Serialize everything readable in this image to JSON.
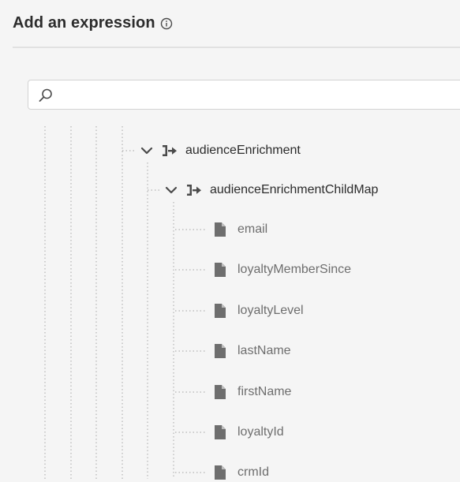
{
  "header": {
    "title": "Add an expression",
    "info_icon": "info-icon"
  },
  "search": {
    "value": "",
    "placeholder": "",
    "icon": "search-icon"
  },
  "tree": {
    "parent": {
      "label": "audienceEnrichment",
      "expand_icon": "chevron-down-icon",
      "type_icon": "object-map-icon"
    },
    "child_map": {
      "label": "audienceEnrichmentChildMap",
      "expand_icon": "chevron-down-icon",
      "type_icon": "object-map-icon"
    },
    "leaves": [
      {
        "label": "email",
        "icon": "file-icon"
      },
      {
        "label": "loyaltyMemberSince",
        "icon": "file-icon"
      },
      {
        "label": "loyaltyLevel",
        "icon": "file-icon"
      },
      {
        "label": "lastName",
        "icon": "file-icon"
      },
      {
        "label": "firstName",
        "icon": "file-icon"
      },
      {
        "label": "loyaltyId",
        "icon": "file-icon"
      },
      {
        "label": "crmId",
        "icon": "file-icon"
      }
    ]
  },
  "colors": {
    "background": "#f5f5f5",
    "text_primary": "#2c2c2c",
    "text_secondary": "#6e6e6e",
    "icon": "#6e6e6e",
    "guide_line": "#b3b3b3"
  }
}
